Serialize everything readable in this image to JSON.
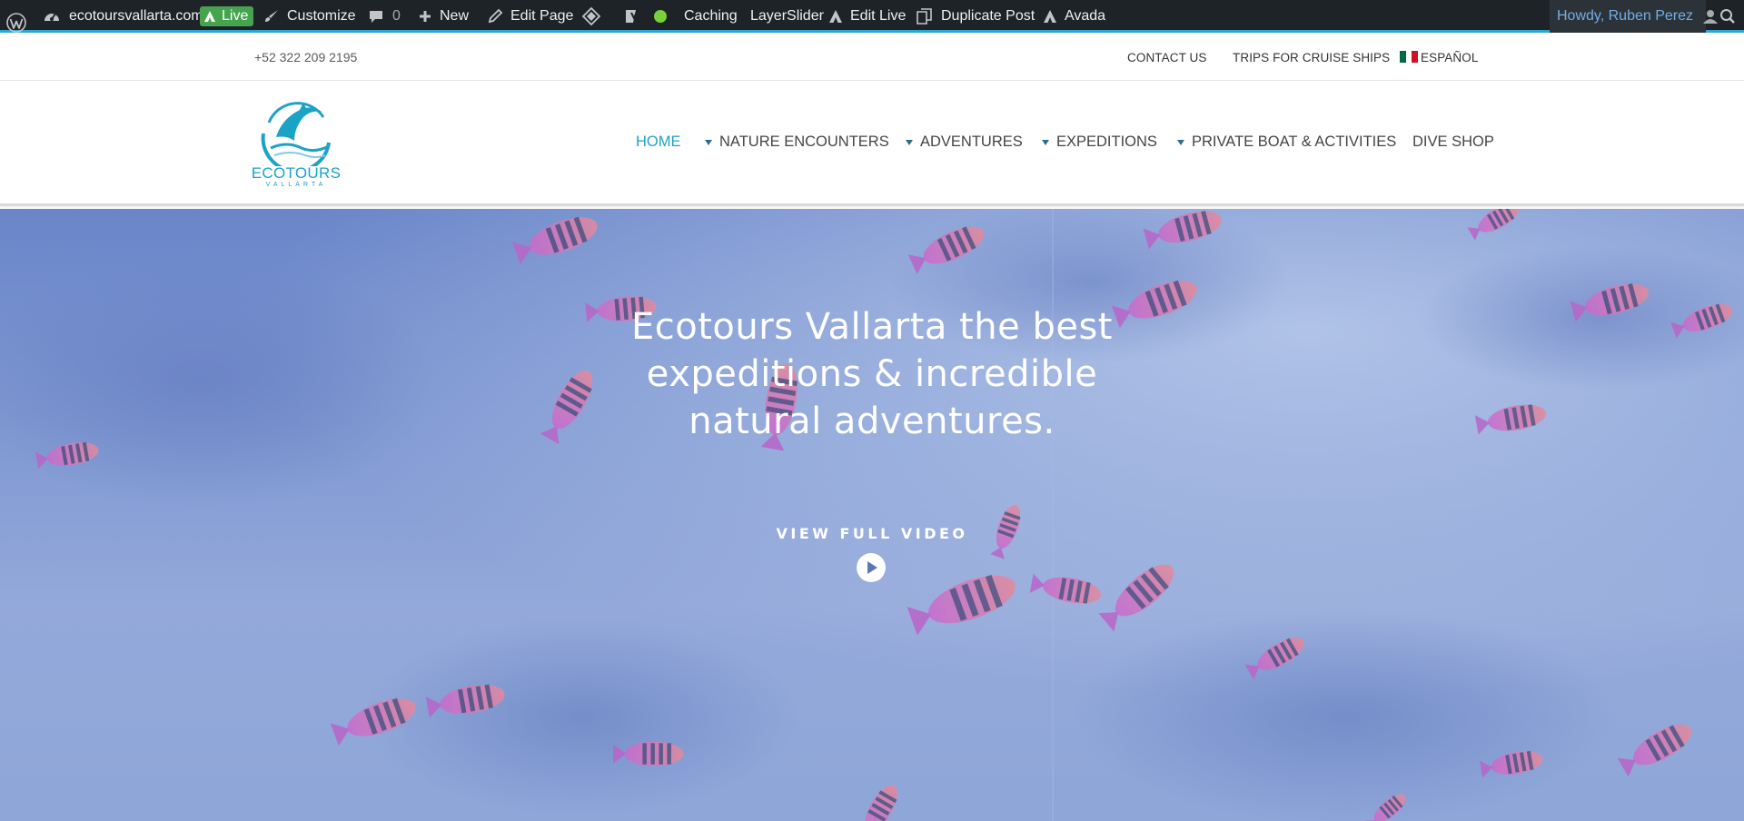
{
  "admin_bar": {
    "site": "ecotoursvallarta.com",
    "live": "Live",
    "customize": "Customize",
    "comments_count": "0",
    "new": "New",
    "edit_page": "Edit Page",
    "caching": "Caching",
    "layerslider": "LayerSlider",
    "edit_live": "Edit Live",
    "duplicate_post": "Duplicate Post",
    "avada": "Avada",
    "account": "Howdy, Ruben Perez",
    "accent_color": "#2aa8d3",
    "live_color": "#46a34e",
    "status_dot_color": "#7ad03a"
  },
  "top_bar": {
    "phone": "+52 322 209 2195",
    "links": [
      "CONTACT US",
      "TRIPS FOR CRUISE SHIPS",
      "ESPAÑOL"
    ]
  },
  "header": {
    "logo_text": "ECOTOURS",
    "logo_subtext": "VALLARTA",
    "brand_color": "#1ba3c6",
    "nav": [
      "HOME",
      "NATURE ENCOUNTERS",
      "ADVENTURES",
      "EXPEDITIONS",
      "PRIVATE BOAT & ACTIVITIES",
      "DIVE SHOP"
    ],
    "active_nav": "HOME"
  },
  "hero": {
    "title_line1": "Ecotours Vallarta the best",
    "title_line2": "expeditions & incredible",
    "title_line3": "natural adventures.",
    "video_label": "VIEW FULL VIDEO"
  }
}
